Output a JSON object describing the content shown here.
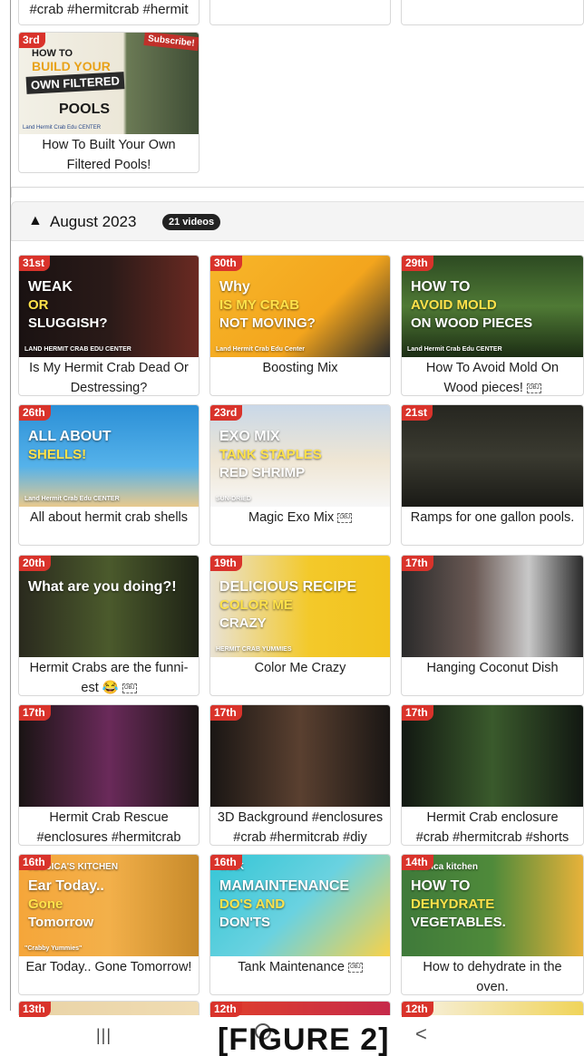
{
  "top_row": {
    "captions": [
      "#crab #hermitcrab #hermit",
      "",
      ""
    ]
  },
  "prev_section": {
    "card": {
      "badge": "3rd",
      "thumb_text": {
        "line1": "HOW TO",
        "line2": "BUILD YOUR",
        "line3": "OWN FILTERED",
        "line4": "POOLS",
        "subscribe": "Subscribe!",
        "footer": "Land Hermit Crab Edu CENTER"
      },
      "caption_l1": "How To Built Your Own",
      "caption_l2": "Filtered Pools!"
    }
  },
  "month": {
    "title": "August 2023",
    "count": "21 videos",
    "chevron_icon": "chevron-up-icon"
  },
  "videos": [
    {
      "badge": "31st",
      "caption_l1": "Is My Hermit Crab Dead Or",
      "caption_l2": "Destressing?",
      "thumb": {
        "t1": "WEAK",
        "t2": "OR",
        "t3": "SLUGGISH?",
        "t4": "LAND HERMIT CRAB EDU CENTER"
      }
    },
    {
      "badge": "30th",
      "caption_l1": "Boosting Mix",
      "caption_l2": "",
      "thumb": {
        "t1": "Why",
        "t2": "IS MY CRAB",
        "t3": "NOT MOVING?",
        "t4": "Land Hermit Crab Edu Center"
      }
    },
    {
      "badge": "29th",
      "caption_l1": "How To Avoid Mold On",
      "caption_l2": "Wood pieces!",
      "obj": "OBJ",
      "thumb": {
        "t1": "HOW TO",
        "t2": "AVOID MOLD",
        "t3": "ON WOOD PIECES",
        "t4": "Land Hermit Crab Edu CENTER"
      }
    },
    {
      "badge": "26th",
      "caption_l1": "All about hermit crab shells",
      "caption_l2": "",
      "thumb": {
        "t1": "ALL ABOUT",
        "t2": "SHELLS!",
        "t4": "Land Hermit Crab Edu CENTER"
      }
    },
    {
      "badge": "23rd",
      "caption_l1": "Magic Exo Mix",
      "caption_l2": "",
      "obj": "OBJ",
      "thumb": {
        "t1": "EXO MIX",
        "t2": "TANK STAPLES",
        "t3": "RED SHRIMP",
        "t4": "SUN-DRIED"
      }
    },
    {
      "badge": "21st",
      "caption_l1": "Ramps for one gallon pools.",
      "caption_l2": "",
      "thumb": {}
    },
    {
      "badge": "20th",
      "caption_l1": "Hermit Crabs are the funni-",
      "caption_l2": "est 😂",
      "obj": "OBJ",
      "thumb": {
        "t1": "What are you doing?!"
      }
    },
    {
      "badge": "19th",
      "caption_l1": "Color Me Crazy",
      "caption_l2": "",
      "thumb": {
        "t1": "DELICIOUS RECIPE",
        "t2": "COLOR ME",
        "t3": "CRAZY",
        "t4": "HERMIT CRAB YUMMIES"
      }
    },
    {
      "badge": "17th",
      "caption_l1": "Hanging Coconut Dish",
      "caption_l2": "",
      "thumb": {}
    },
    {
      "badge": "17th",
      "caption_l1": "Hermit Crab Rescue",
      "caption_l2": "#enclosures #hermitcrab",
      "thumb": {}
    },
    {
      "badge": "17th",
      "caption_l1": "3D Background #enclosures",
      "caption_l2": "#crab #hermitcrab #diy",
      "thumb": {}
    },
    {
      "badge": "17th",
      "caption_l1": "Hermit Crab enclosure",
      "caption_l2": "#crab #hermitcrab #shorts",
      "thumb": {}
    },
    {
      "badge": "16th",
      "caption_l1": "Ear Today.. Gone Tomorrow!",
      "caption_l2": "",
      "thumb": {
        "t0": "JESSICA'S KITCHEN",
        "t1": "Ear Today..",
        "t2": "Gone",
        "t3": "Tomorrow",
        "t4": "\"Crabby Yummies\""
      }
    },
    {
      "badge": "16th",
      "caption_l1": "Tank Maintenance",
      "caption_l2": "",
      "obj": "OBJ",
      "thumb": {
        "t0": "TANK",
        "t1": "MAMAINTENANCE",
        "t2": "DO'S AND",
        "t3": "DON'TS"
      }
    },
    {
      "badge": "14th",
      "caption_l1": "How to dehydrate in the",
      "caption_l2": "oven.",
      "thumb": {
        "t0": "Jessica kitchen",
        "t1": "HOW TO",
        "t2": "DEHYDRATE",
        "t3": "VEGETABLES."
      }
    },
    {
      "badge": "13th",
      "caption_l1": "",
      "caption_l2": "",
      "thumb": {}
    },
    {
      "badge": "12th",
      "caption_l1": "",
      "caption_l2": "",
      "thumb": {}
    },
    {
      "badge": "12th",
      "caption_l1": "",
      "caption_l2": "",
      "thumb": {}
    }
  ],
  "nav": {
    "recents": "|||",
    "back": "<"
  },
  "figure_label": "[FIGURE 2]",
  "colors": {
    "badge": "#d9332b",
    "count_pill": "#222222",
    "header_bg": "#f4f4f4"
  }
}
